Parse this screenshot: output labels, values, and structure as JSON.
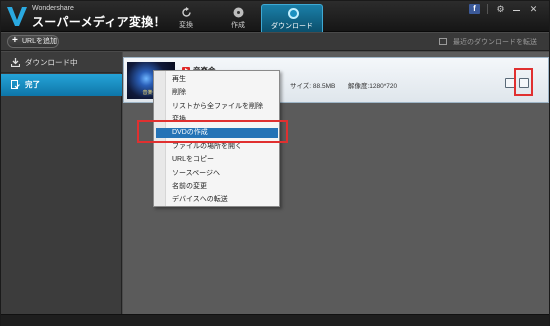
{
  "app": {
    "brand_small": "Wondershare",
    "brand_name": "スーパーメディア変換！"
  },
  "tabs": [
    {
      "label": "変換",
      "icon": "refresh-icon"
    },
    {
      "label": "作成",
      "icon": "disc-icon"
    },
    {
      "label": "ダウンロード",
      "icon": "download-icon",
      "active": true
    }
  ],
  "window_controls": {
    "facebook": "f",
    "settings_icon": "gear-icon",
    "minimize_icon": "minimize-icon",
    "close": "✕"
  },
  "toolbar": {
    "add_url_label": "URLを追加",
    "transfer_label": "最近のダウンロードを転送"
  },
  "sidebar": {
    "items": [
      {
        "label": "ダウンロード中",
        "icon": "download-icon",
        "active": false
      },
      {
        "label": "完了",
        "icon": "completed-icon",
        "active": true
      }
    ]
  },
  "download_item": {
    "title": "音楽会",
    "size": "サイズ: 88.5MB",
    "resolution": "解像度:1280*720",
    "thumbnail_caption": "音楽会"
  },
  "context_menu": {
    "items": [
      {
        "label": "再生",
        "selected": false
      },
      {
        "label": "削除",
        "selected": false
      },
      {
        "label": "リストから全ファイルを削除",
        "selected": false
      },
      {
        "label": "変換",
        "selected": false
      },
      {
        "label": "DVDの作成",
        "selected": true
      },
      {
        "label": "ファイルの場所を開く",
        "selected": false
      },
      {
        "label": "URLをコピー",
        "selected": false
      },
      {
        "label": "ソースページへ",
        "selected": false
      },
      {
        "label": "名前の変更",
        "selected": false
      },
      {
        "label": "デバイスへの転送",
        "selected": false
      }
    ]
  },
  "colors": {
    "accent": "#1a90c0",
    "selection": "#2573b6",
    "highlight": "#e03030"
  }
}
